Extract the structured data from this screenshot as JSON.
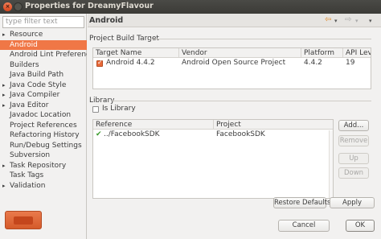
{
  "window": {
    "title": "Properties for DreamyFlavour",
    "close_glyph": "×"
  },
  "sidebar": {
    "filter_placeholder": "type filter text",
    "items": [
      {
        "label": "Resource",
        "expandable": true,
        "selected": false
      },
      {
        "label": "Android",
        "expandable": false,
        "selected": true
      },
      {
        "label": "Android Lint Preferences",
        "expandable": false,
        "selected": false
      },
      {
        "label": "Builders",
        "expandable": false,
        "selected": false
      },
      {
        "label": "Java Build Path",
        "expandable": false,
        "selected": false
      },
      {
        "label": "Java Code Style",
        "expandable": true,
        "selected": false
      },
      {
        "label": "Java Compiler",
        "expandable": true,
        "selected": false
      },
      {
        "label": "Java Editor",
        "expandable": true,
        "selected": false
      },
      {
        "label": "Javadoc Location",
        "expandable": false,
        "selected": false
      },
      {
        "label": "Project References",
        "expandable": false,
        "selected": false
      },
      {
        "label": "Refactoring History",
        "expandable": false,
        "selected": false
      },
      {
        "label": "Run/Debug Settings",
        "expandable": false,
        "selected": false
      },
      {
        "label": "Subversion",
        "expandable": false,
        "selected": false
      },
      {
        "label": "Task Repository",
        "expandable": true,
        "selected": false
      },
      {
        "label": "Task Tags",
        "expandable": false,
        "selected": false
      },
      {
        "label": "Validation",
        "expandable": true,
        "selected": false
      }
    ]
  },
  "page": {
    "title": "Android",
    "nav_glyphs": {
      "back": "⇦",
      "forward": "⇨",
      "dropdown": "▾"
    },
    "build_target": {
      "label": "Project Build Target",
      "columns": [
        "Target Name",
        "Vendor",
        "Platform",
        "API Leve"
      ],
      "rows": [
        {
          "checked": true,
          "name": "Android 4.4.2",
          "vendor": "Android Open Source Project",
          "platform": "4.4.2",
          "api": "19"
        }
      ]
    },
    "library": {
      "label": "Library",
      "is_library_label": "Is Library",
      "is_library_checked": false,
      "columns": [
        "Reference",
        "Project"
      ],
      "rows": [
        {
          "status": "✔",
          "reference": "../FacebookSDK",
          "project": "FacebookSDK"
        }
      ],
      "buttons": {
        "add": "Add...",
        "remove": "Remove",
        "up": "Up",
        "down": "Down"
      }
    },
    "restore_defaults": "Restore Defaults",
    "apply": "Apply"
  },
  "footer": {
    "cancel": "Cancel",
    "ok": "OK"
  },
  "colors": {
    "accent": "#f07746",
    "ok_button": "#e96a3a"
  }
}
